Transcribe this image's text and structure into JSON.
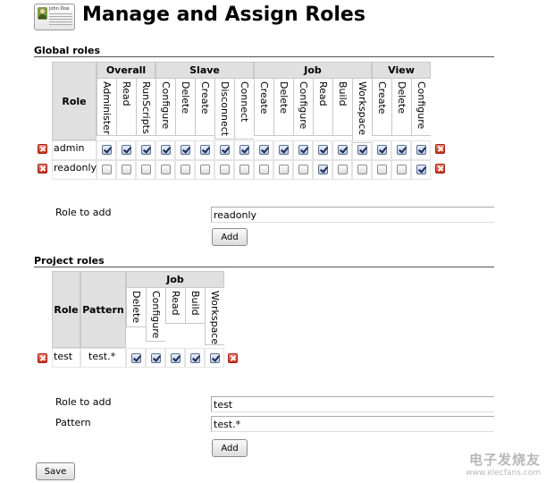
{
  "header": {
    "user_name": "John Doe",
    "title": "Manage and Assign Roles"
  },
  "global": {
    "section_title": "Global roles",
    "role_header": "Role",
    "groups": [
      "Overall",
      "Slave",
      "Job",
      "View"
    ],
    "permissions": [
      "Administer",
      "Read",
      "RunScripts",
      "Configure",
      "Delete",
      "Create",
      "Disconnect",
      "Connect",
      "Create",
      "Delete",
      "Configure",
      "Read",
      "Build",
      "Workspace",
      "Create",
      "Delete",
      "Configure"
    ],
    "rows": [
      {
        "name": "admin",
        "checks": [
          1,
          1,
          1,
          1,
          1,
          1,
          1,
          1,
          1,
          1,
          1,
          1,
          1,
          1,
          1,
          1,
          1
        ]
      },
      {
        "name": "readonly",
        "checks": [
          0,
          0,
          0,
          0,
          0,
          0,
          0,
          0,
          0,
          0,
          0,
          1,
          0,
          0,
          0,
          0,
          1
        ]
      }
    ],
    "role_to_add_label": "Role to add",
    "role_to_add_value": "readonly",
    "add_label": "Add"
  },
  "project": {
    "section_title": "Project roles",
    "role_header": "Role",
    "pattern_header": "Pattern",
    "group": "Job",
    "permissions": [
      "Delete",
      "Configure",
      "Read",
      "Build",
      "Workspace"
    ],
    "rows": [
      {
        "name": "test",
        "pattern": "test.*",
        "checks": [
          1,
          1,
          1,
          1,
          1
        ]
      }
    ],
    "role_to_add_label": "Role to add",
    "role_to_add_value": "test",
    "pattern_label": "Pattern",
    "pattern_value": "test.*",
    "add_label": "Add"
  },
  "save_label": "Save",
  "watermark": {
    "line1": "电子发烧友",
    "line2": "www.elecfans.com"
  },
  "colors": {
    "header_bg": "#e0e0e0",
    "delete_red": "#c8301e",
    "check_blue": "#1b2a55"
  }
}
